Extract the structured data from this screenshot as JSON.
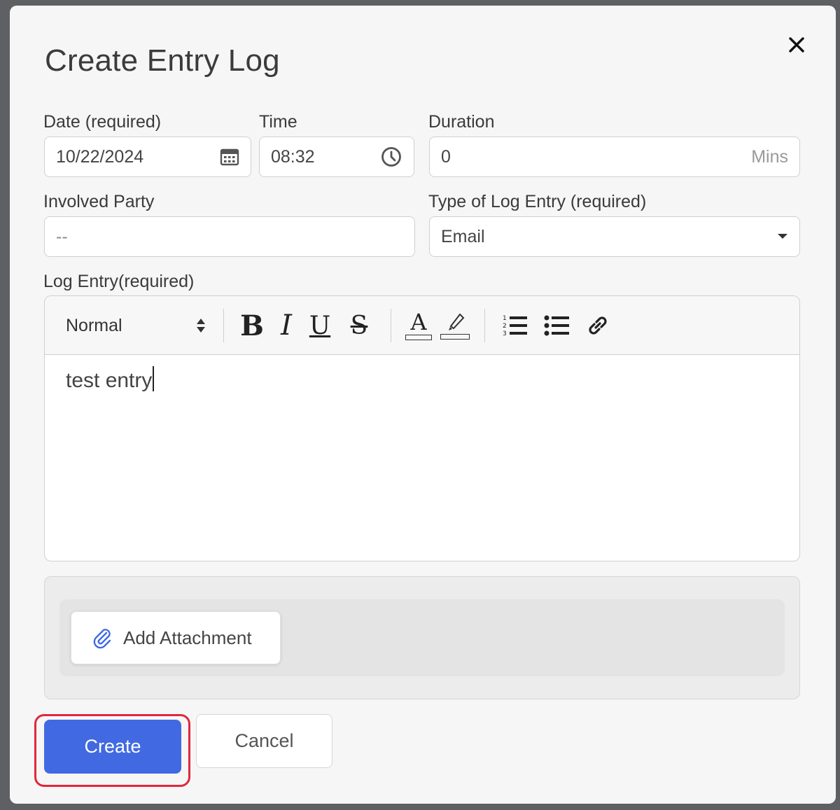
{
  "modal": {
    "title": "Create Entry Log"
  },
  "form": {
    "date": {
      "label": "Date (required)",
      "value": "10/22/2024"
    },
    "time": {
      "label": "Time",
      "value": "08:32"
    },
    "duration": {
      "label": "Duration",
      "value": "0",
      "suffix": "Mins"
    },
    "involved_party": {
      "label": "Involved Party",
      "value": "--"
    },
    "log_type": {
      "label": "Type of Log Entry (required)",
      "value": "Email"
    },
    "log_entry": {
      "label": "Log Entry(required)",
      "text": "test entry"
    }
  },
  "toolbar": {
    "format_select": "Normal",
    "bold": "B",
    "italic": "I",
    "underline": "U",
    "strike": "S",
    "text_color": "A"
  },
  "attachment": {
    "button_label": "Add Attachment"
  },
  "actions": {
    "create_label": "Create",
    "cancel_label": "Cancel"
  },
  "colors": {
    "primary": "#4169e1",
    "highlight_ring": "#e0283c",
    "attach_icon": "#4169e1"
  },
  "icons": [
    "close-icon",
    "calendar-icon",
    "clock-icon",
    "caret-down-icon",
    "sort-arrows-icon",
    "text-color-icon",
    "highlighter-icon",
    "ordered-list-icon",
    "bullet-list-icon",
    "link-icon",
    "paperclip-icon"
  ]
}
